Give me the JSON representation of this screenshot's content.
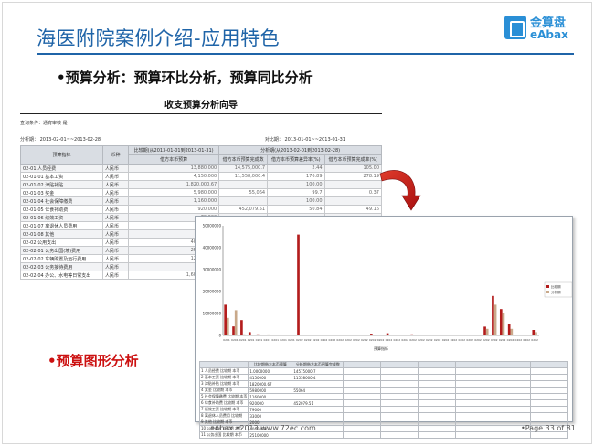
{
  "slide": {
    "title": "海医附院案例介绍-应用特色",
    "logo_cn": "金算盘",
    "logo_en": "eAbax",
    "bullet1": "•预算分析：预算环比分析，预算同比分析",
    "bullet2": "•预算图形分析",
    "footer": "eAbax  •2013  www.72ec.com",
    "page": "•Page 33 of  81"
  },
  "report": {
    "title": "收支预算分析向导",
    "condition": "查询条件：通宵审核 是",
    "period_left": "分析期：  2013-02-01~~2013-02-28",
    "period_right": "对比期：  2013-01-01~~2013-01-31",
    "headers": [
      "预算指标",
      "币种",
      "比较期(从2013-01-01到2013-01-31)",
      "分析期(从2013-02-01到2013-02-28)"
    ],
    "subheaders": [
      "借方本币预算",
      "借方本币预算完成数",
      "借方本币预算差异率(%)",
      "借方本币预算完成率(%)"
    ],
    "rows": [
      {
        "code": "02-01 人员经费",
        "cur": "人民币"
      },
      {
        "code": "02-01-01 基本工资",
        "cur": "人民币"
      },
      {
        "code": "02-01-02 津贴补贴",
        "cur": "人民币"
      },
      {
        "code": "02-01-03 奖金",
        "cur": "人民币"
      },
      {
        "code": "02-01-04 社会保障缴费",
        "cur": "人民币"
      },
      {
        "code": "02-01-05 伙食补助费",
        "cur": "人民币"
      },
      {
        "code": "02-01-06 绩效工资",
        "cur": "人民币"
      },
      {
        "code": "02-01-07 离退休人员费用",
        "cur": "人民币"
      },
      {
        "code": "02-01-08 其他",
        "cur": "人民币"
      },
      {
        "code": "02-02 公用支出",
        "cur": "人民币"
      },
      {
        "code": "02-02-01 公务出国(境)费用",
        "cur": "人民币"
      },
      {
        "code": "02-02-02 车辆购置及运行费用",
        "cur": "人民币"
      },
      {
        "code": "02-02-03 公务接待费用",
        "cur": "人民币"
      },
      {
        "code": "02-02-04 办公、水电等日常支出",
        "cur": "人民币"
      }
    ],
    "values": [
      [
        "13,880,000",
        "14,575,000.7",
        "2.44",
        "105.00"
      ],
      [
        "4,150,000",
        "11,558,000.4",
        "176.89",
        "278.19"
      ],
      [
        "1,820,000.67",
        "",
        "100.00",
        ""
      ],
      [
        "5,980,000",
        "55,064",
        "99.7",
        "0.37"
      ],
      [
        "1,160,000",
        "",
        "100.00",
        ""
      ],
      [
        "920,000",
        "452,079.51",
        "50.84",
        "49.16"
      ],
      [
        "79,000",
        "",
        "",
        ""
      ],
      [
        "33,000",
        "",
        "",
        ""
      ],
      [
        "2,000",
        "",
        "",
        ""
      ],
      [
        "40,650,000",
        "",
        "",
        ""
      ],
      [
        "25,100,000",
        "",
        "",
        ""
      ],
      [
        "12,300,000",
        "",
        "",
        ""
      ],
      [
        "180,000",
        "",
        "",
        ""
      ],
      [
        "1,600,000.84",
        "",
        "",
        ""
      ]
    ]
  },
  "chart": {
    "y_ticks": [
      "50000000",
      "40000000",
      "30000000",
      "20000000",
      "10000000",
      "0"
    ],
    "legend": [
      "比较期",
      "分析期"
    ],
    "colors": {
      "compare": "#b31c1c",
      "analysis": "#c9a98a"
    },
    "x_axis_label": "预算指标",
    "table_headers": [
      "",
      "比较期借方本币预算",
      "分析期借方本币预算完成数"
    ],
    "table_rows": [
      [
        "1 人员经费  比较期  本币",
        "1.0000000",
        "14575000.7"
      ],
      [
        "2 基本工资  比较期  本币",
        "4150000",
        "11558000.4"
      ],
      [
        "3 津贴补贴  比较期  本币",
        "1820000.67",
        ""
      ],
      [
        "4 奖金  比较期  本币",
        "5980000",
        "55064"
      ],
      [
        "5 社会保障缴费  比较期  本币",
        "1160000",
        ""
      ],
      [
        "6 伙食补助费  比较期  本币",
        "920000",
        "452079.51"
      ],
      [
        "7 绩效工资  比较期  本币",
        "79000",
        ""
      ],
      [
        "8 离退休人员费用  比较期",
        "33000",
        ""
      ],
      [
        "9 其他  比较期  本币",
        "2000",
        ""
      ],
      [
        "10 公用支出  比较期  本币",
        "40650000",
        ""
      ],
      [
        "11 公务出国  比较期  本币",
        "25100000",
        ""
      ]
    ]
  },
  "chart_data": {
    "type": "bar",
    "ylim": [
      0,
      50000000
    ],
    "categories": [
      "0201",
      "0201",
      "0201",
      "0201",
      "0201",
      "0201",
      "0201",
      "0201",
      "0201",
      "0202",
      "0202",
      "0202",
      "0202",
      "0202",
      "0202",
      "0202",
      "0202",
      "0202",
      "0202",
      "0202",
      "0202",
      "0202",
      "0202",
      "0202",
      "0202",
      "0202",
      "0202",
      "0202",
      "0202",
      "0202",
      "0202",
      "0202",
      "0202",
      "0202",
      "0202",
      "0202",
      "0202",
      "0202",
      "0202"
    ],
    "series": [
      {
        "name": "比较期",
        "values": [
          14000000,
          4100000,
          7000000,
          1500000,
          500000,
          100000,
          100000,
          300000,
          200000,
          46000000,
          300000,
          200000,
          100000,
          400000,
          150000,
          200000,
          100000,
          300000,
          800000,
          200000,
          1000000,
          300000,
          200000,
          500000,
          200000,
          400000,
          300000,
          300000,
          200000,
          200000,
          300000,
          200000,
          4000000,
          18000000,
          12000000,
          5000000,
          200000,
          400000,
          2500000
        ]
      },
      {
        "name": "分析期",
        "values": [
          8000000,
          11500000,
          500000,
          0,
          0,
          450000,
          0,
          0,
          0,
          100000,
          0,
          0,
          0,
          0,
          0,
          0,
          0,
          0,
          0,
          0,
          0,
          0,
          0,
          0,
          0,
          0,
          0,
          0,
          0,
          0,
          0,
          0,
          3000000,
          14000000,
          10000000,
          3000000,
          0,
          0,
          1500000
        ]
      }
    ]
  }
}
